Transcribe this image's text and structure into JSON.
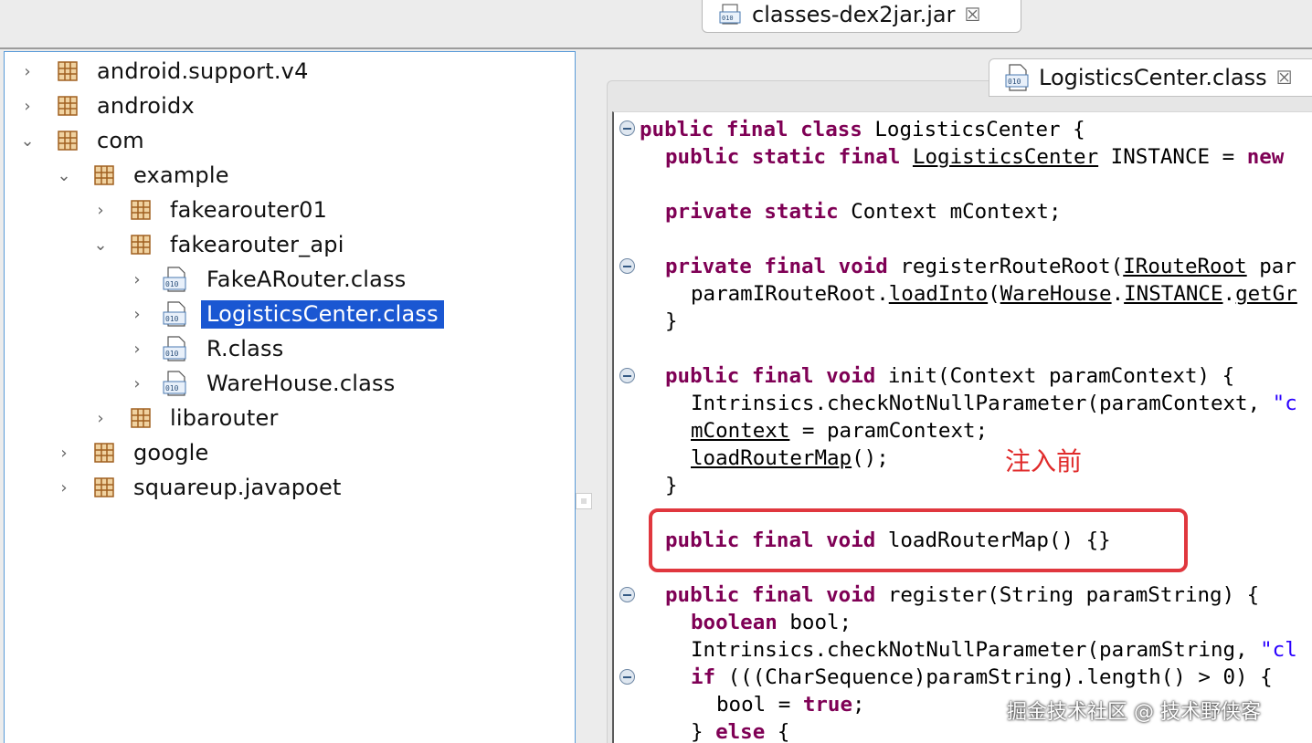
{
  "editor_tab": {
    "title": "classes-dex2jar.jar",
    "icon": "jar-file-icon",
    "close": "☒"
  },
  "tree": [
    {
      "label": "android.support.v4",
      "kind": "package",
      "arrow": "›",
      "depth": 0
    },
    {
      "label": "androidx",
      "kind": "package",
      "arrow": "›",
      "depth": 0
    },
    {
      "label": "com",
      "kind": "package",
      "arrow": "⌄",
      "depth": 0
    },
    {
      "label": "example",
      "kind": "package",
      "arrow": "⌄",
      "depth": 1
    },
    {
      "label": "fakearouter01",
      "kind": "package",
      "arrow": "›",
      "depth": 2
    },
    {
      "label": "fakearouter_api",
      "kind": "package",
      "arrow": "⌄",
      "depth": 2
    },
    {
      "label": "FakeARouter.class",
      "kind": "class",
      "arrow": "›",
      "depth": 3
    },
    {
      "label": "LogisticsCenter.class",
      "kind": "class",
      "arrow": "›",
      "depth": 3,
      "selected": true
    },
    {
      "label": "R.class",
      "kind": "class",
      "arrow": "›",
      "depth": 3
    },
    {
      "label": "WareHouse.class",
      "kind": "class",
      "arrow": "›",
      "depth": 3
    },
    {
      "label": "libarouter",
      "kind": "package",
      "arrow": "›",
      "depth": 2
    },
    {
      "label": "google",
      "kind": "package",
      "arrow": "›",
      "depth": 1
    },
    {
      "label": "squareup.javapoet",
      "kind": "package",
      "arrow": "›",
      "depth": 1
    }
  ],
  "inner_tab": {
    "title": "LogisticsCenter.class",
    "icon": "class-file-icon",
    "close": "☒"
  },
  "code": {
    "l1": {
      "kw": "public final class",
      "rest": " LogisticsCenter {"
    },
    "l2": {
      "kw": "public static final",
      "ref": "LogisticsCenter",
      "rest": " INSTANCE = ",
      "kw2": "new"
    },
    "l3": {
      "kw": "private static",
      "rest": " Context mContext;"
    },
    "l4": {
      "kw": "private final void",
      "rest": " registerRouteRoot(",
      "ref": "IRouteRoot",
      "rest2": " par"
    },
    "l5": {
      "ref1": "paramIRouteRoot",
      "dot1": ".",
      "ref2": "loadInto",
      "paren": "(",
      "ref3": "WareHouse",
      "dot2": ".",
      "ref4": "INSTANCE",
      "dot3": ".",
      "ref5": "getGr"
    },
    "l6": "}",
    "l7": {
      "kw": "public final void",
      "rest": " init(Context paramContext) {"
    },
    "l8": {
      "rest": "Intrinsics.checkNotNullParameter(paramContext, ",
      "str": "\"c"
    },
    "l9": {
      "ref": "mContext",
      "rest": " = paramContext;"
    },
    "l10": {
      "ref": "loadRouterMap",
      "rest": "();"
    },
    "l11": "}",
    "l12": {
      "kw": "public final void",
      "rest": " loadRouterMap() {}"
    },
    "l13": {
      "kw": "public final void",
      "rest": " register(String paramString) {"
    },
    "l14": {
      "kw": "boolean",
      "rest": " bool;"
    },
    "l15": {
      "rest": "Intrinsics.checkNotNullParameter(paramString, ",
      "str": "\"cl"
    },
    "l16": {
      "kw": "if",
      "rest": " (((CharSequence)paramString).length() > 0) {"
    },
    "l17": {
      "rest": "bool = ",
      "kw": "true",
      "rest2": ";"
    },
    "l18": {
      "rest": "} ",
      "kw": "else",
      "rest2": " {"
    }
  },
  "annotation": "注入前",
  "watermark": "掘金技术社区 @ 技术野侠客"
}
